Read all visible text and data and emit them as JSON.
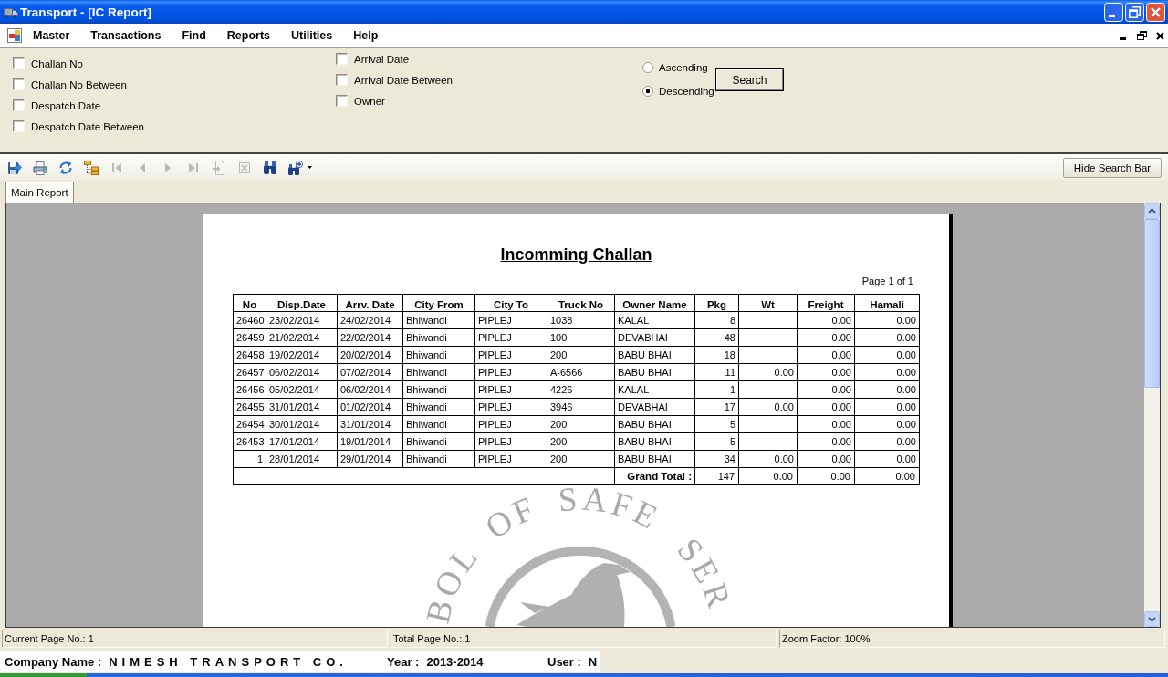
{
  "window": {
    "title": "Transport - [IC Report]"
  },
  "menu": [
    {
      "label": "Master"
    },
    {
      "label": "Transactions"
    },
    {
      "label": "Find"
    },
    {
      "label": "Reports"
    },
    {
      "label": "Utilities"
    },
    {
      "label": "Help"
    }
  ],
  "search_panel": {
    "filter_columns": [
      {
        "filters": [
          {
            "label": "Challan No",
            "checked": false
          },
          {
            "label": "Challan No Between",
            "checked": false
          },
          {
            "label": "Despatch Date",
            "checked": false
          },
          {
            "label": "Despatch Date Between",
            "checked": false
          }
        ]
      },
      {
        "filters": [
          {
            "label": "Arrival Date",
            "checked": false
          },
          {
            "label": "Arrival Date Between",
            "checked": false
          },
          {
            "label": "Owner",
            "checked": false
          }
        ]
      }
    ],
    "sort_options": [
      {
        "label": "Ascending",
        "selected": false
      },
      {
        "label": "Descending",
        "selected": true
      }
    ],
    "search_button": "Search"
  },
  "toolbar": {
    "tools": [
      {
        "kind": "export",
        "disabled": false
      },
      {
        "kind": "print",
        "disabled": false
      },
      {
        "kind": "refresh",
        "disabled": false
      },
      {
        "kind": "group_tree",
        "disabled": false
      },
      {
        "kind": "first",
        "disabled": true
      },
      {
        "kind": "previous",
        "disabled": true
      },
      {
        "kind": "next",
        "disabled": true
      },
      {
        "kind": "last",
        "disabled": true
      },
      {
        "kind": "goto",
        "disabled": true
      },
      {
        "kind": "stop",
        "disabled": true
      },
      {
        "kind": "find",
        "disabled": false
      },
      {
        "kind": "zoom",
        "disabled": false
      }
    ],
    "hide_button": "Hide Search Bar"
  },
  "tabs": [
    {
      "label": "Main Report",
      "selected": true
    }
  ],
  "report": {
    "title": "Incomming Challan",
    "page_label": "Page 1 of 1",
    "columns": [
      {
        "label": "No",
        "kind": "number"
      },
      {
        "label": "Disp.Date",
        "kind": "text"
      },
      {
        "label": "Arrv. Date",
        "kind": "text"
      },
      {
        "label": "City From",
        "kind": "text"
      },
      {
        "label": "City To",
        "kind": "text"
      },
      {
        "label": "Truck No",
        "kind": "text"
      },
      {
        "label": "Owner Name",
        "kind": "text"
      },
      {
        "label": "Pkg",
        "kind": "number"
      },
      {
        "label": "Wt",
        "kind": "number"
      },
      {
        "label": "Freight",
        "kind": "number"
      },
      {
        "label": "Hamali",
        "kind": "number"
      }
    ],
    "rows": [
      [
        "26460",
        "23/02/2014",
        "24/02/2014",
        "Bhiwandi",
        "PIPLEJ",
        "1038",
        "KALAL",
        "8",
        null,
        "0.00",
        "0.00"
      ],
      [
        "26459",
        "21/02/2014",
        "22/02/2014",
        "Bhiwandi",
        "PIPLEJ",
        "100",
        "DEVABHAI",
        "48",
        null,
        "0.00",
        "0.00"
      ],
      [
        "26458",
        "19/02/2014",
        "20/02/2014",
        "Bhiwandi",
        "PIPLEJ",
        "200",
        "BABU BHAI",
        "18",
        null,
        "0.00",
        "0.00"
      ],
      [
        "26457",
        "06/02/2014",
        "07/02/2014",
        "Bhiwandi",
        "PIPLEJ",
        "A-6566",
        "BABU BHAI",
        "11",
        "0.00",
        "0.00",
        "0.00"
      ],
      [
        "26456",
        "05/02/2014",
        "06/02/2014",
        "Bhiwandi",
        "PIPLEJ",
        "4226",
        "KALAL",
        "1",
        null,
        "0.00",
        "0.00"
      ],
      [
        "26455",
        "31/01/2014",
        "01/02/2014",
        "Bhiwandi",
        "PIPLEJ",
        "3946",
        "DEVABHAI",
        "17",
        "0.00",
        "0.00",
        "0.00"
      ],
      [
        "26454",
        "30/01/2014",
        "31/01/2014",
        "Bhiwandi",
        "PIPLEJ",
        "200",
        "BABU BHAI",
        "5",
        null,
        "0.00",
        "0.00"
      ],
      [
        "26453",
        "17/01/2014",
        "19/01/2014",
        "Bhiwandi",
        "PIPLEJ",
        "200",
        "BABU BHAI",
        "5",
        null,
        "0.00",
        "0.00"
      ],
      [
        "1",
        "28/01/2014",
        "29/01/2014",
        "Bhiwandi",
        "PIPLEJ",
        "200",
        "BABU BHAI",
        "34",
        "0.00",
        "0.00",
        "0.00"
      ]
    ],
    "totals": {
      "label": "Grand Total :",
      "values": [
        "147",
        "0.00",
        "0.00",
        "0.00"
      ]
    },
    "seal": {
      "words": [
        "BOL",
        "OF",
        "SAFE",
        "SER"
      ]
    }
  },
  "status_bar": [
    "Current Page No.: 1",
    "Total Page No.: 1",
    "Zoom Factor: 100%"
  ],
  "footer": [
    {
      "label": "Company Name :",
      "value": "NIMESH TRANSPORT CO."
    },
    {
      "label": "Year :",
      "value": "2013-2014"
    },
    {
      "label": "User :",
      "value": "N"
    }
  ]
}
